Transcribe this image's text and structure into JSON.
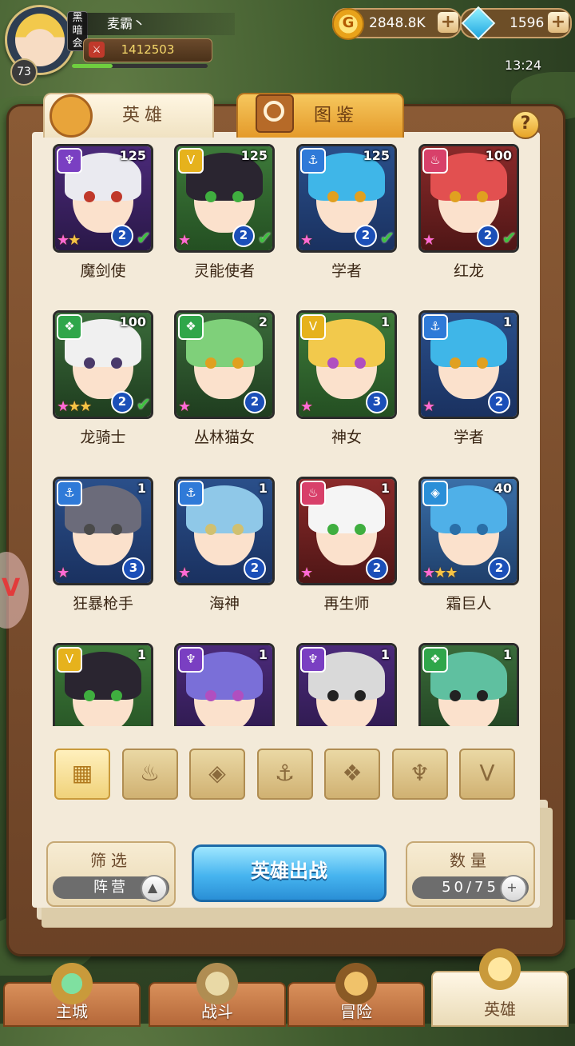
{
  "player": {
    "name": "麦霸丶",
    "level": "73",
    "vip": "黑暗会",
    "power": "1412503",
    "exp_fraction": 0.3
  },
  "currency": {
    "gold": "2848.8K",
    "gems": "1596"
  },
  "clock": "13:24",
  "tabs": {
    "heroes": "英雄",
    "codex": "图鉴"
  },
  "help_label": "?",
  "heroes": [
    {
      "name": "魔剑使",
      "level": "125",
      "faction": "dark",
      "stars": 2,
      "grade": "2",
      "check": true
    },
    {
      "name": "灵能使者",
      "level": "125",
      "faction": "light",
      "stars": 1,
      "grade": "2",
      "check": true
    },
    {
      "name": "学者",
      "level": "125",
      "faction": "water",
      "stars": 1,
      "grade": "2",
      "check": true
    },
    {
      "name": "红龙",
      "level": "100",
      "faction": "fire",
      "stars": 1,
      "grade": "2",
      "check": true
    },
    {
      "name": "龙骑士",
      "level": "100",
      "faction": "beast",
      "stars": 3,
      "grade": "2",
      "check": true
    },
    {
      "name": "丛林猫女",
      "level": "2",
      "faction": "beast",
      "stars": 1,
      "grade": "2",
      "check": false
    },
    {
      "name": "神女",
      "level": "1",
      "faction": "light",
      "stars": 1,
      "grade": "3",
      "check": false
    },
    {
      "name": "学者",
      "level": "1",
      "faction": "water",
      "stars": 1,
      "grade": "2",
      "check": false
    },
    {
      "name": "狂暴枪手",
      "level": "1",
      "faction": "water",
      "stars": 1,
      "grade": "3",
      "check": false
    },
    {
      "name": "海神",
      "level": "1",
      "faction": "water",
      "stars": 1,
      "grade": "2",
      "check": false
    },
    {
      "name": "再生师",
      "level": "1",
      "faction": "fire",
      "stars": 1,
      "grade": "2",
      "check": false
    },
    {
      "name": "霜巨人",
      "level": "40",
      "faction": "ice",
      "stars": 3,
      "grade": "2",
      "check": false
    },
    {
      "name": "",
      "level": "1",
      "faction": "light",
      "stars": 0,
      "grade": "",
      "check": false
    },
    {
      "name": "",
      "level": "1",
      "faction": "dark",
      "stars": 0,
      "grade": "",
      "check": false
    },
    {
      "name": "",
      "level": "1",
      "faction": "dark",
      "stars": 0,
      "grade": "",
      "check": false
    },
    {
      "name": "",
      "level": "1",
      "faction": "beast",
      "stars": 0,
      "grade": "",
      "check": false
    }
  ],
  "faction_filters": [
    "all-grid-icon",
    "fire-faction-icon",
    "ice-faction-icon",
    "anchor-faction-icon",
    "beast-faction-icon",
    "dark-faction-icon",
    "light-faction-icon"
  ],
  "filter_panel": {
    "title": "筛选",
    "value": "阵营"
  },
  "deploy_button": "英雄出战",
  "count_panel": {
    "title": "数量",
    "value": "50/75"
  },
  "nav": {
    "city": "主城",
    "battle": "战斗",
    "adventure": "冒险",
    "heroes": "英雄"
  }
}
